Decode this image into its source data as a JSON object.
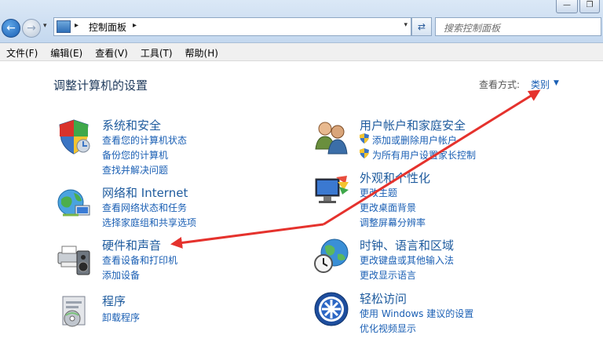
{
  "window": {
    "min_glyph": "—",
    "max_glyph": "❐"
  },
  "nav": {
    "back_glyph": "←",
    "fwd_glyph": "→",
    "drop_glyph": "▾"
  },
  "address": {
    "separator": "▸",
    "path": "控制面板",
    "drop_glyph": "▾"
  },
  "refresh_glyph": "⇄",
  "search": {
    "placeholder": "搜索控制面板"
  },
  "menu": [
    "文件(F)",
    "编辑(E)",
    "查看(V)",
    "工具(T)",
    "帮助(H)"
  ],
  "page_title": "调整计算机的设置",
  "view_by": {
    "label": "查看方式:",
    "value": "类别",
    "arrow": "▼"
  },
  "categories": {
    "system": {
      "title": "系统和安全",
      "links": [
        "查看您的计算机状态",
        "备份您的计算机",
        "查找并解决问题"
      ]
    },
    "network": {
      "title": "网络和 Internet",
      "links": [
        "查看网络状态和任务",
        "选择家庭组和共享选项"
      ]
    },
    "hardware": {
      "title": "硬件和声音",
      "links": [
        "查看设备和打印机",
        "添加设备"
      ]
    },
    "programs": {
      "title": "程序",
      "links": [
        "卸载程序"
      ]
    },
    "users": {
      "title": "用户帐户和家庭安全",
      "links": [
        "添加或删除用户帐户",
        "为所有用户设置家长控制"
      ]
    },
    "appearance": {
      "title": "外观和个性化",
      "links": [
        "更改主题",
        "更改桌面背景",
        "调整屏幕分辨率"
      ]
    },
    "clock": {
      "title": "时钟、语言和区域",
      "links": [
        "更改键盘或其他输入法",
        "更改显示语言"
      ]
    },
    "ease": {
      "title": "轻松访问",
      "links": [
        "使用 Windows 建议的设置",
        "优化视频显示"
      ]
    }
  },
  "colors": {
    "link": "#1a5fb4",
    "title": "#1e5b9e",
    "heading": "#1e395b",
    "arrow": "#e5322d"
  }
}
